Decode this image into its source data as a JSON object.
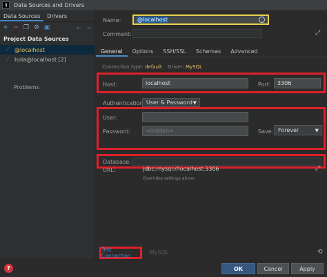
{
  "window": {
    "title": "Data Sources and Drivers",
    "app_icon_text": "IJ"
  },
  "left_panel": {
    "tabs": [
      "Data Sources",
      "Drivers"
    ],
    "section_title": "Project Data Sources",
    "items": [
      {
        "label": "@localhost",
        "selected": true
      },
      {
        "label": "hola@localhost [2]",
        "selected": false
      }
    ],
    "problems_label": "Problems"
  },
  "form": {
    "name_label": "Name:",
    "name_value": "@localhost",
    "comment_label": "Comment:",
    "tabs": [
      "General",
      "Options",
      "SSH/SSL",
      "Schemas",
      "Advanced"
    ],
    "connection_type_label": "Connection type:",
    "connection_type_value": "default",
    "driver_label": "Driver:",
    "driver_value": "MySQL",
    "host_label": "Host:",
    "host_value": "localhost",
    "port_label": "Port:",
    "port_value": "3306",
    "auth_label": "Authentication:",
    "auth_value": "User & Password",
    "user_label": "User:",
    "user_value": "",
    "password_label": "Password:",
    "password_placeholder": "<hidden>",
    "save_label": "Save:",
    "save_value": "Forever",
    "database_label": "Database:",
    "database_value": "",
    "url_label": "URL:",
    "url_value": "jdbc:mysql://localhost:3306",
    "url_note": "Overrides settings above",
    "test_connection_label": "Test Connection",
    "mysql_label": "MySQL"
  },
  "footer": {
    "help": "?",
    "ok": "OK",
    "cancel": "Cancel",
    "apply": "Apply"
  },
  "colors": {
    "highlight_box": "#e0202a",
    "name_border": "#e8d44d",
    "accent": "#4a88c7"
  }
}
